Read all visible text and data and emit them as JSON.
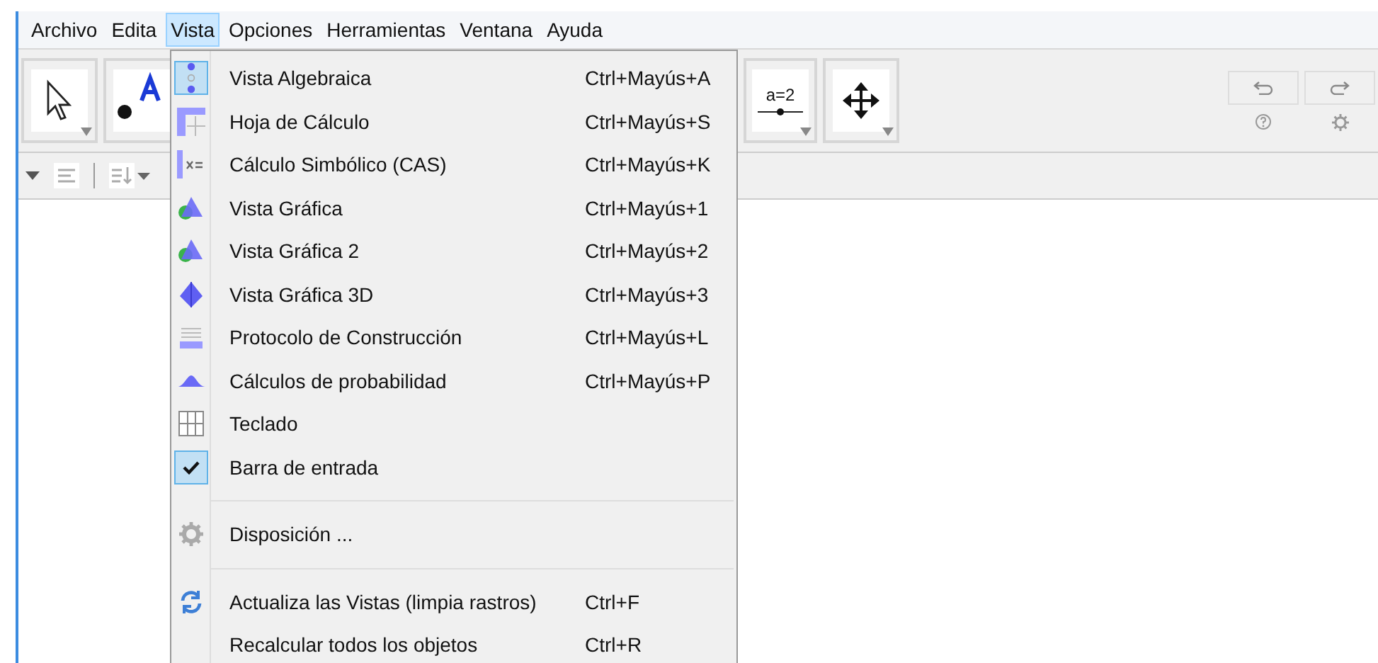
{
  "menubar": [
    {
      "label": "Archivo",
      "selected": false
    },
    {
      "label": "Edita",
      "selected": false
    },
    {
      "label": "Vista",
      "selected": true
    },
    {
      "label": "Opciones",
      "selected": false
    },
    {
      "label": "Herramientas",
      "selected": false
    },
    {
      "label": "Ventana",
      "selected": false
    },
    {
      "label": "Ayuda",
      "selected": false
    }
  ],
  "toolbar": {
    "slider_label": "a=2"
  },
  "menu": {
    "groups": [
      [
        {
          "kind": "view",
          "label": "Vista Algebraica",
          "shortcut": "Ctrl+Mayús+A",
          "checked": true
        },
        {
          "kind": "view",
          "label": "Hoja de Cálculo",
          "shortcut": "Ctrl+Mayús+S",
          "checked": false
        },
        {
          "kind": "view",
          "label": "Cálculo Simbólico (CAS)",
          "shortcut": "Ctrl+Mayús+K",
          "checked": false
        },
        {
          "kind": "view",
          "label": "Vista Gráfica",
          "shortcut": "Ctrl+Mayús+1",
          "checked": false
        },
        {
          "kind": "view",
          "label": "Vista Gráfica 2",
          "shortcut": "Ctrl+Mayús+2",
          "checked": false
        },
        {
          "kind": "view",
          "label": "Vista Gráfica 3D",
          "shortcut": "Ctrl+Mayús+3",
          "checked": false
        },
        {
          "kind": "view",
          "label": "Protocolo de Construcción",
          "shortcut": "Ctrl+Mayús+L",
          "checked": false
        },
        {
          "kind": "view",
          "label": "Cálculos de probabilidad",
          "shortcut": "Ctrl+Mayús+P",
          "checked": false
        },
        {
          "kind": "view",
          "label": "Teclado",
          "checked": false
        },
        {
          "kind": "check",
          "label": "Barra de entrada",
          "checked": true
        }
      ],
      [
        {
          "kind": "action",
          "label": "Disposición ..."
        }
      ],
      [
        {
          "kind": "action",
          "label": "Actualiza las Vistas (limpia rastros)",
          "shortcut": "Ctrl+F"
        },
        {
          "kind": "action",
          "label": "Recalcular todos los objetos",
          "shortcut": "Ctrl+R"
        }
      ]
    ]
  }
}
